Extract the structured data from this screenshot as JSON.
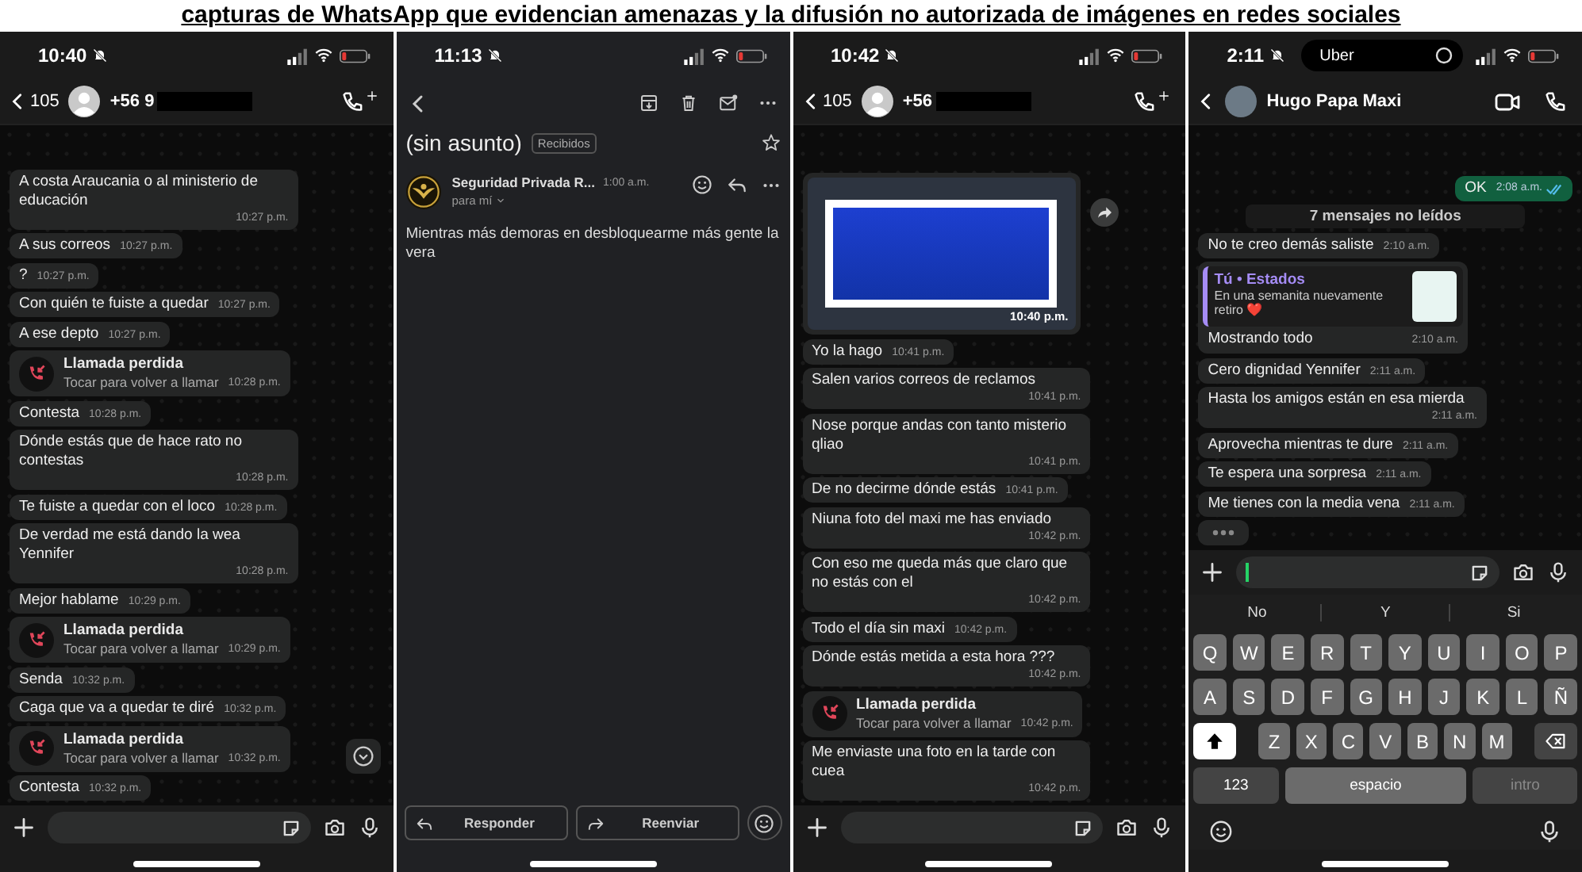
{
  "heading": "capturas de WhatsApp que evidencian amenazas y la difusión no autorizada de imágenes en redes sociales",
  "screens": [
    {
      "kind": "chat",
      "status": {
        "time": "10:40"
      },
      "header": {
        "kind": "number",
        "back_count": "105",
        "contact": "+56 9"
      },
      "scroll_button": true,
      "messages": [
        {
          "kind": "text",
          "text": "A costa Araucania o al ministerio de educación",
          "time": "10:27 p.m."
        },
        {
          "kind": "text",
          "text": "A sus correos",
          "time": "10:27 p.m."
        },
        {
          "kind": "text",
          "text": "?",
          "time": "10:27 p.m."
        },
        {
          "kind": "text",
          "text": "Con quién te fuiste a quedar",
          "time": "10:27 p.m."
        },
        {
          "kind": "text",
          "text": "A ese depto",
          "time": "10:27 p.m."
        },
        {
          "kind": "call",
          "title": "Llamada perdida",
          "subtitle": "Tocar para volver a llamar",
          "time": "10:28 p.m."
        },
        {
          "kind": "text",
          "text": "Contesta",
          "time": "10:28 p.m."
        },
        {
          "kind": "text",
          "text": "Dónde estás que de hace rato no contestas",
          "time": "10:28 p.m."
        },
        {
          "kind": "text",
          "text": "Te fuiste a quedar con el loco",
          "time": "10:28 p.m."
        },
        {
          "kind": "text",
          "text": "De verdad me está dando la wea Yennifer",
          "time": "10:28 p.m."
        },
        {
          "kind": "text",
          "text": "Mejor hablame",
          "time": "10:29 p.m."
        },
        {
          "kind": "call",
          "title": "Llamada perdida",
          "subtitle": "Tocar para volver a llamar",
          "time": "10:29 p.m."
        },
        {
          "kind": "text",
          "text": "Senda",
          "time": "10:32 p.m."
        },
        {
          "kind": "text",
          "text": "Caga que va a quedar te diré",
          "time": "10:32 p.m."
        },
        {
          "kind": "call",
          "title": "Llamada perdida",
          "subtitle": "Tocar para volver a llamar",
          "time": "10:32 p.m."
        },
        {
          "kind": "text",
          "text": "Contesta",
          "time": "10:32 p.m."
        }
      ],
      "composer": {
        "cursor": false
      }
    },
    {
      "kind": "email",
      "status": {
        "time": "11:13"
      },
      "subject": "(sin asunto)",
      "label": "Recibidos",
      "sender": "Seguridad Privada R...",
      "time": "1:00 a.m.",
      "recipient": "para mí",
      "body": "Mientras más demoras en desbloquearme más gente la vera",
      "actions": [
        "Responder",
        "Reenviar"
      ]
    },
    {
      "kind": "chat",
      "status": {
        "time": "10:42"
      },
      "header": {
        "kind": "number",
        "back_count": "105",
        "contact": "+56"
      },
      "scroll_button": false,
      "messages": [
        {
          "kind": "image",
          "time": "10:40 p.m."
        },
        {
          "kind": "text",
          "text": "Yo la hago",
          "time": "10:41 p.m."
        },
        {
          "kind": "text",
          "text": "Salen varios correos de reclamos",
          "time": "10:41 p.m."
        },
        {
          "kind": "text",
          "text": "Nose porque andas con tanto misterio qliao",
          "time": "10:41 p.m."
        },
        {
          "kind": "text",
          "text": "De no decirme dónde estás",
          "time": "10:41 p.m."
        },
        {
          "kind": "text",
          "text": "Niuna foto del maxi me has enviado",
          "time": "10:42 p.m."
        },
        {
          "kind": "text",
          "text": "Con eso me queda más que claro que no estás con el",
          "time": "10:42 p.m."
        },
        {
          "kind": "text",
          "text": "Todo el día sin maxi",
          "time": "10:42 p.m."
        },
        {
          "kind": "text",
          "text": "Dónde estás metida a esta hora ???",
          "time": "10:42 p.m."
        },
        {
          "kind": "call",
          "title": "Llamada perdida",
          "subtitle": "Tocar para volver a llamar",
          "time": "10:42 p.m."
        },
        {
          "kind": "text",
          "text": "Me enviaste una foto en la tarde con cuea",
          "time": "10:42 p.m."
        }
      ],
      "composer": {
        "cursor": false
      }
    },
    {
      "kind": "chat",
      "status": {
        "time": "2:11",
        "island": "Uber"
      },
      "header": {
        "kind": "contact",
        "contact": "Hugo Papa Maxi"
      },
      "scroll_button": false,
      "messages": [
        {
          "kind": "out",
          "text": "OK",
          "time": "2:08 a.m."
        },
        {
          "kind": "divider",
          "text": "7 mensajes no leídos"
        },
        {
          "kind": "text",
          "text": "No te creo demás saliste",
          "time": "2:10 a.m."
        },
        {
          "kind": "quote",
          "author": "Tú • Estados",
          "quote": "En una semanita nuevamente retiro ❤️",
          "text": "Mostrando todo",
          "time": "2:10 a.m."
        },
        {
          "kind": "text",
          "text": "Cero dignidad Yennifer",
          "time": "2:11 a.m."
        },
        {
          "kind": "text",
          "text": "Hasta los amigos están en esa mierda",
          "time": "2:11 a.m."
        },
        {
          "kind": "text",
          "text": "Aprovecha mientras te dure",
          "time": "2:11 a.m."
        },
        {
          "kind": "text",
          "text": "Te espera una sorpresa",
          "time": "2:11 a.m."
        },
        {
          "kind": "text",
          "text": "Me tienes con la media vena",
          "time": "2:11 a.m."
        },
        {
          "kind": "typing"
        }
      ],
      "composer": {
        "cursor": true
      },
      "keyboard": {
        "suggestions": [
          "No",
          "Y",
          "Si"
        ],
        "shift_active": true,
        "rows": [
          [
            "Q",
            "W",
            "E",
            "R",
            "T",
            "Y",
            "U",
            "I",
            "O",
            "P"
          ],
          [
            "A",
            "S",
            "D",
            "F",
            "G",
            "H",
            "J",
            "K",
            "L",
            "Ñ"
          ],
          [
            "Z",
            "X",
            "C",
            "V",
            "B",
            "N",
            "M"
          ]
        ],
        "bottom": [
          {
            "label": "123",
            "disabled": false
          },
          {
            "label": "espacio",
            "disabled": false
          },
          {
            "label": "intro",
            "disabled": true
          }
        ]
      }
    }
  ]
}
